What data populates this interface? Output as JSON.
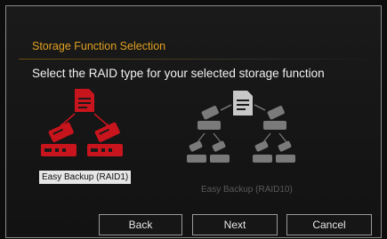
{
  "wizard": {
    "section_title": "Storage Function Selection",
    "prompt": "Select the RAID type for your selected storage function"
  },
  "options": [
    {
      "label": "Easy Backup (RAID1)",
      "selected": true,
      "icon": "raid1-diagram-icon"
    },
    {
      "label": "Easy Backup (RAID10)",
      "selected": false,
      "icon": "raid10-diagram-icon"
    }
  ],
  "buttons": {
    "back": "Back",
    "next": "Next",
    "cancel": "Cancel"
  },
  "colors": {
    "accent": "#e0a020",
    "selected_icon": "#c8141c",
    "disabled_icon": "#7a7a7a"
  }
}
